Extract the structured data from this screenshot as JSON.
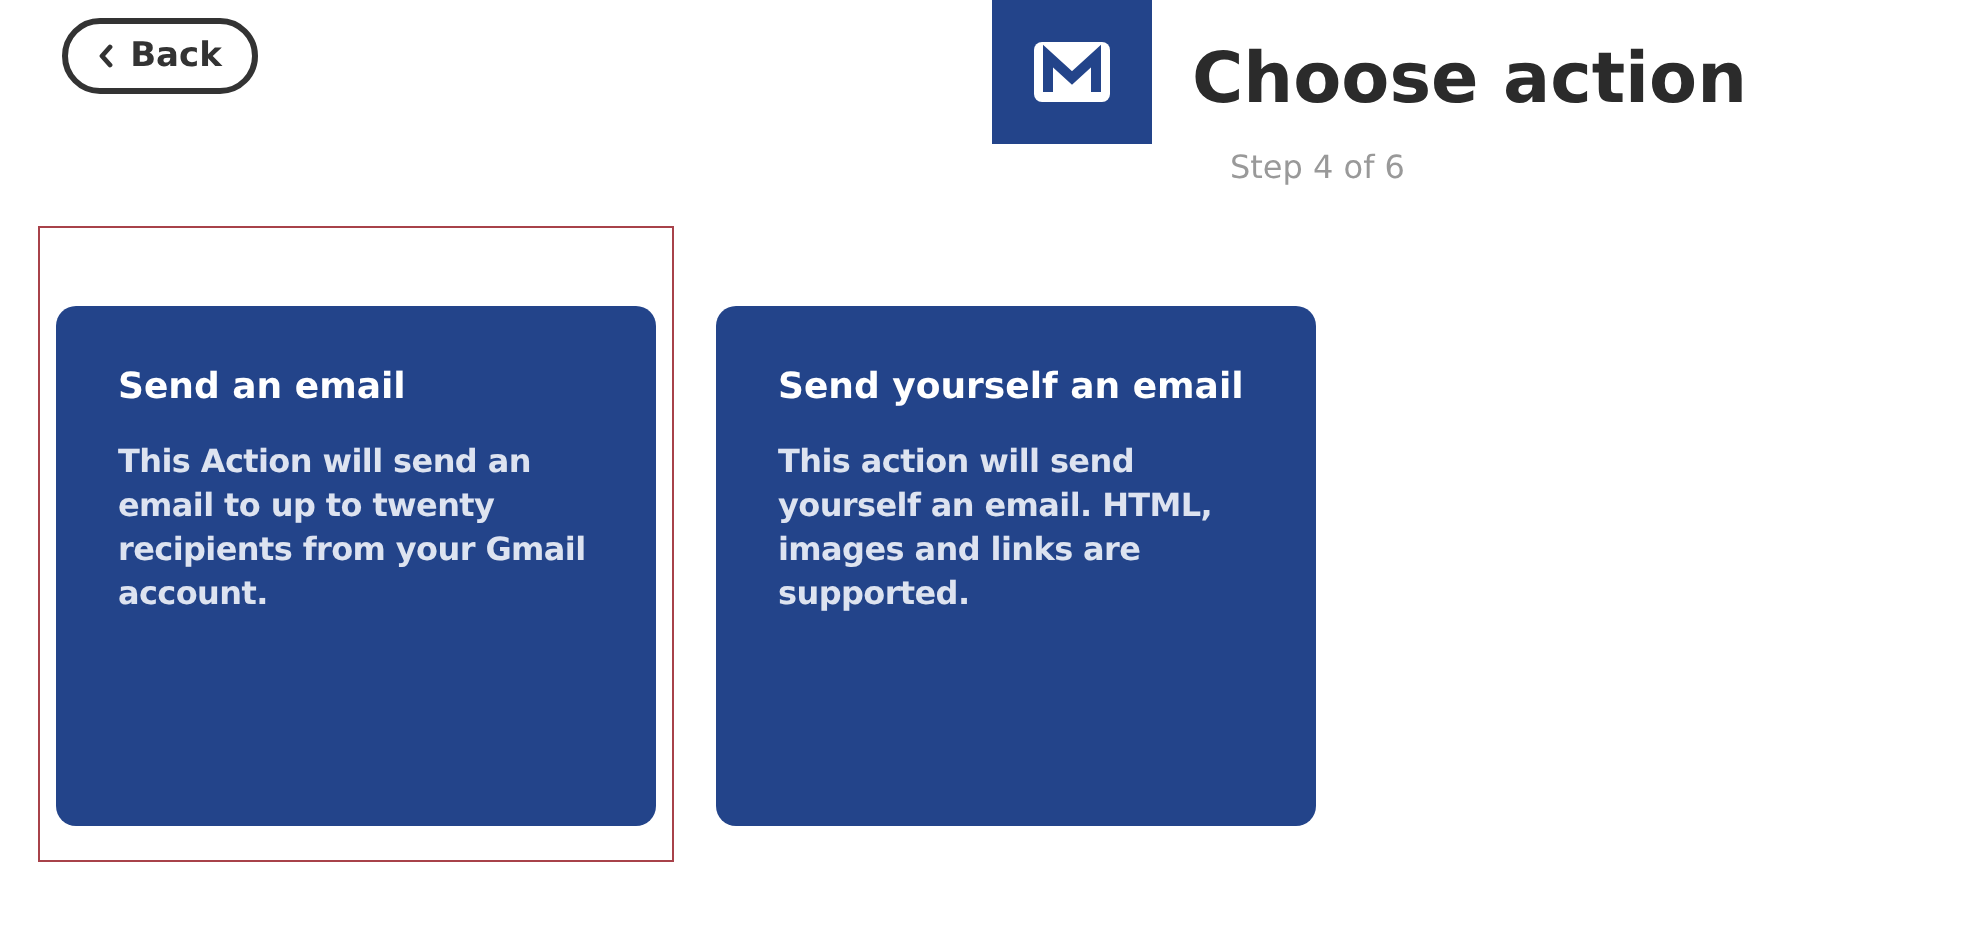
{
  "back_button": {
    "label": "Back"
  },
  "header": {
    "title": "Choose action",
    "step": "Step 4 of 6"
  },
  "actions": [
    {
      "title": "Send an email",
      "description": "This Action will send an email to up to twenty recipients from your Gmail account.",
      "selected": true
    },
    {
      "title": "Send yourself an email",
      "description": "This action will send yourself an email. HTML, images and links are supported.",
      "selected": false
    }
  ]
}
